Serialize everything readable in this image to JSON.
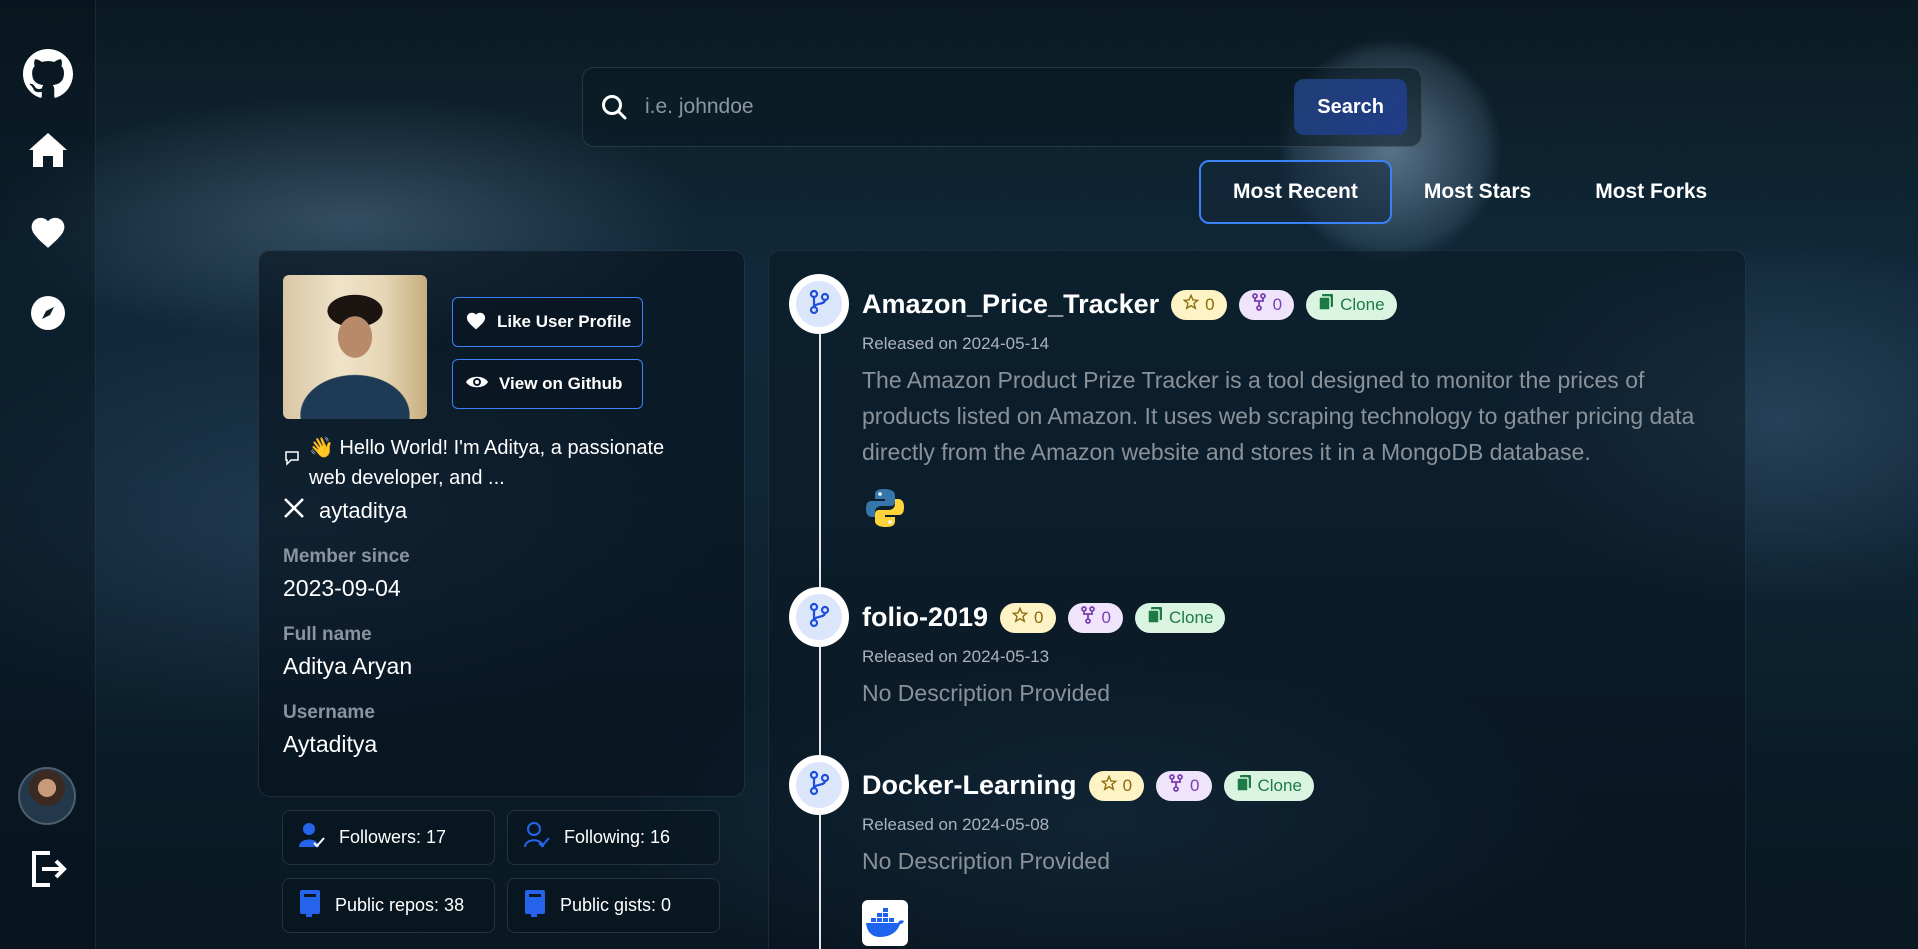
{
  "sidebar": {
    "icons": [
      "github-icon",
      "home-icon",
      "heart-icon",
      "compass-icon",
      "avatar",
      "logout-icon"
    ]
  },
  "search": {
    "placeholder": "i.e. johndoe",
    "button_label": "Search"
  },
  "sort_tabs": [
    {
      "label": "Most Recent",
      "active": true
    },
    {
      "label": "Most Stars",
      "active": false
    },
    {
      "label": "Most Forks",
      "active": false
    }
  ],
  "profile": {
    "like_button": "Like User Profile",
    "github_button": "View on Github",
    "bio": "👋 Hello World! I'm Aditya, a passionate web developer, and ...",
    "twitter": "aytaditya",
    "member_since_label": "Member since",
    "member_since": "2023-09-04",
    "full_name_label": "Full name",
    "full_name": "Aditya Aryan",
    "username_label": "Username",
    "username": "Aytaditya"
  },
  "stats": {
    "followers": "Followers: 17",
    "following": "Following: 16",
    "public_repos": "Public repos: 38",
    "public_gists": "Public gists: 0"
  },
  "repos": [
    {
      "name": "Amazon_Price_Tracker",
      "stars": "0",
      "forks": "0",
      "clone_label": "Clone",
      "released": "Released on 2024-05-14",
      "description": "The Amazon Product Prize Tracker is a tool designed to monitor the prices of products listed on Amazon. It uses web scraping technology to gather pricing data directly from the Amazon website and stores it in a MongoDB database.",
      "language_icon": "python-icon"
    },
    {
      "name": "folio-2019",
      "stars": "0",
      "forks": "0",
      "clone_label": "Clone",
      "released": "Released on 2024-05-13",
      "description": "No Description Provided"
    },
    {
      "name": "Docker-Learning",
      "stars": "0",
      "forks": "0",
      "clone_label": "Clone",
      "released": "Released on 2024-05-08",
      "description": "No Description Provided",
      "language_icon": "docker-icon"
    }
  ],
  "colors": {
    "accent": "#3b82f6",
    "search_button": "#1e3f73",
    "star_badge": "#fdf3c4",
    "fork_badge": "#efe4fb",
    "clone_badge": "#d9f5e2"
  }
}
